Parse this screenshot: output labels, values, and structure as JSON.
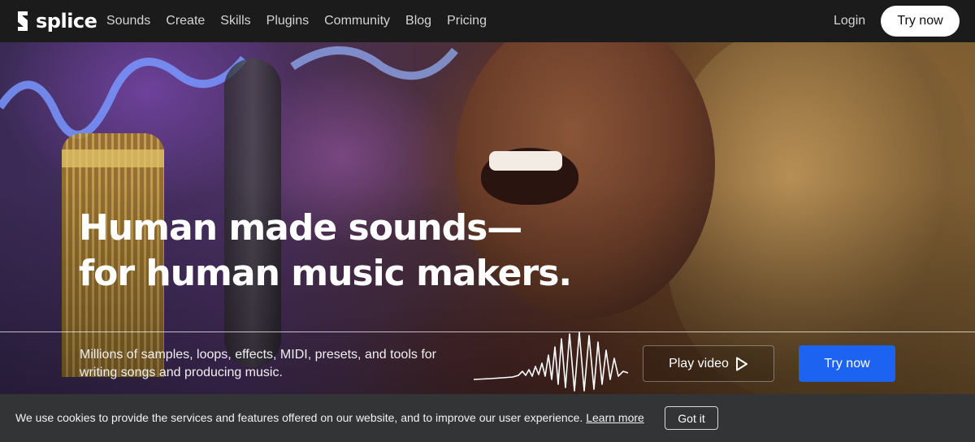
{
  "brand": {
    "name": "splice"
  },
  "nav": {
    "links": [
      "Sounds",
      "Create",
      "Skills",
      "Plugins",
      "Community",
      "Blog",
      "Pricing"
    ],
    "login": "Login",
    "try_now": "Try now"
  },
  "hero": {
    "headline_line1": "Human made sounds—",
    "headline_line2": "for human music makers.",
    "subtext": "Millions of samples, loops, effects, MIDI, presets, and tools for writing songs and producing music.",
    "play_video": "Play video",
    "try_now": "Try now"
  },
  "cookie": {
    "text": "We use cookies to provide the services and features offered on our website, and to improve our user experience.",
    "learn_more": "Learn more",
    "got_it": "Got it"
  },
  "colors": {
    "accent": "#1d63f2",
    "nav_bg": "#1b1b1c",
    "cookie_bg": "#323436"
  },
  "icons": {
    "logo": "splice-logo-icon",
    "play": "play-icon",
    "waveform": "waveform-graphic"
  }
}
